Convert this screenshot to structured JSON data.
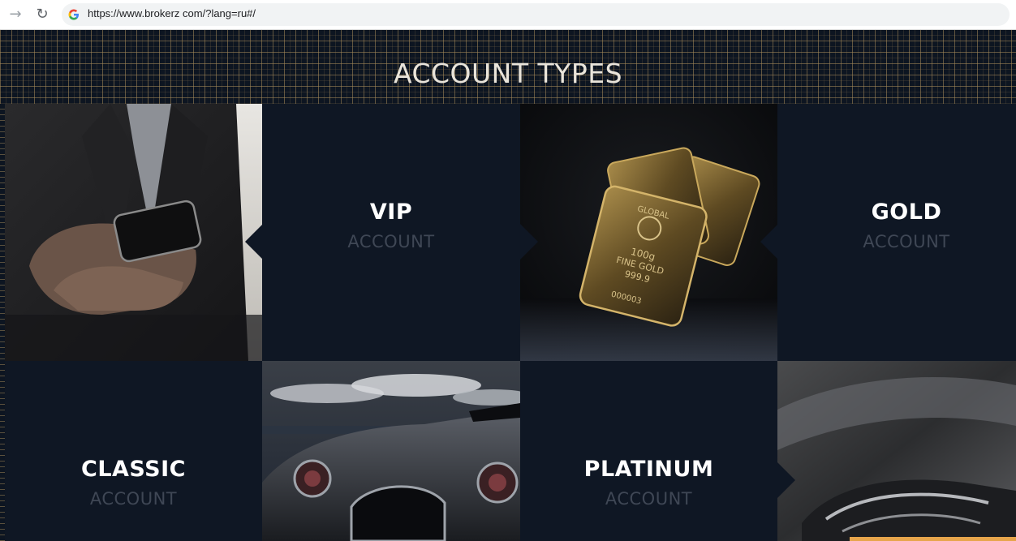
{
  "browser": {
    "url": "https://www.brokerz com/?lang=ru#/"
  },
  "page": {
    "section_title": "ACCOUNT TYPES",
    "accounts": [
      {
        "type": "VIP",
        "sub": "ACCOUNT"
      },
      {
        "type": "GOLD",
        "sub": "ACCOUNT"
      },
      {
        "type": "CLASSIC",
        "sub": "ACCOUNT"
      },
      {
        "type": "PLATINUM",
        "sub": "ACCOUNT"
      }
    ],
    "images": {
      "phone": "man-holding-smartphone-photo",
      "gold": "gold-bars-photo",
      "car": "classic-car-photo",
      "platinum": "platinum-car-detail-photo"
    },
    "gold_bar_text": [
      "GLOBAL",
      "100g",
      "FINE GOLD",
      "999.9",
      "000003"
    ]
  },
  "colors": {
    "accent": "#e7a54b",
    "panel": "#0f1724",
    "title": "#e9e4da",
    "subtitle": "#3f4755"
  }
}
